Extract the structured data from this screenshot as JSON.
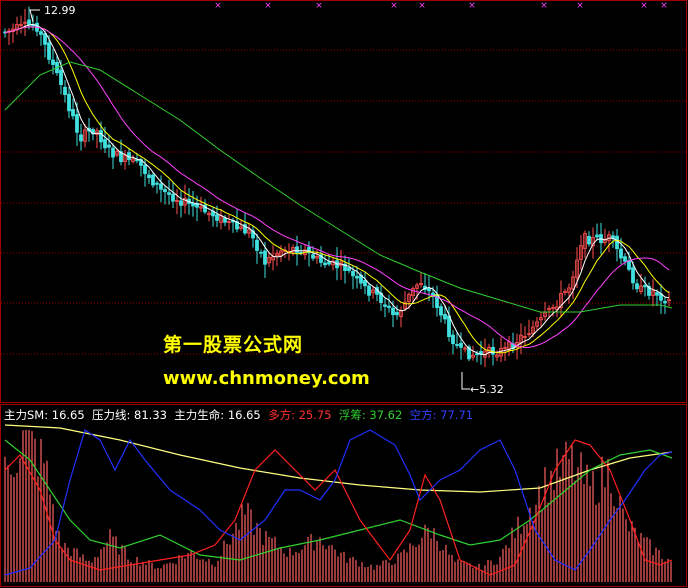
{
  "watermark": {
    "line1": "第一股票公式网",
    "line2": "www.chnmoney.com"
  },
  "price_panel": {
    "high_label": "12.99",
    "low_label": "5.32",
    "top_markers": [
      "×",
      "×",
      "×",
      "×",
      "×",
      "×",
      "×",
      "×",
      "×",
      "×"
    ]
  },
  "indicator_bar": {
    "items": [
      {
        "label": "主力SM",
        "value": "16.65",
        "color": "#ffffff"
      },
      {
        "label": "压力线",
        "value": "81.33",
        "color": "#ffffff"
      },
      {
        "label": "主力生命",
        "value": "16.65",
        "color": "#ffffff"
      },
      {
        "label": "多方",
        "value": "25.75",
        "color": "#ff3030"
      },
      {
        "label": "浮筹",
        "value": "37.62",
        "color": "#30d030"
      },
      {
        "label": "空方",
        "value": "77.71",
        "color": "#3040ff"
      }
    ]
  },
  "colors": {
    "background": "#000000",
    "grid": "#a00000",
    "up": "#ff5050",
    "down": "#40e0e0",
    "ma5": "#ffffff",
    "ma10": "#ffff00",
    "ma20": "#ff40ff",
    "ma60": "#30d030",
    "sm_line": "#ffffff",
    "pressure": "#ffff80",
    "bull": "#ff2020",
    "float": "#30d030",
    "bear": "#2030ff"
  }
}
